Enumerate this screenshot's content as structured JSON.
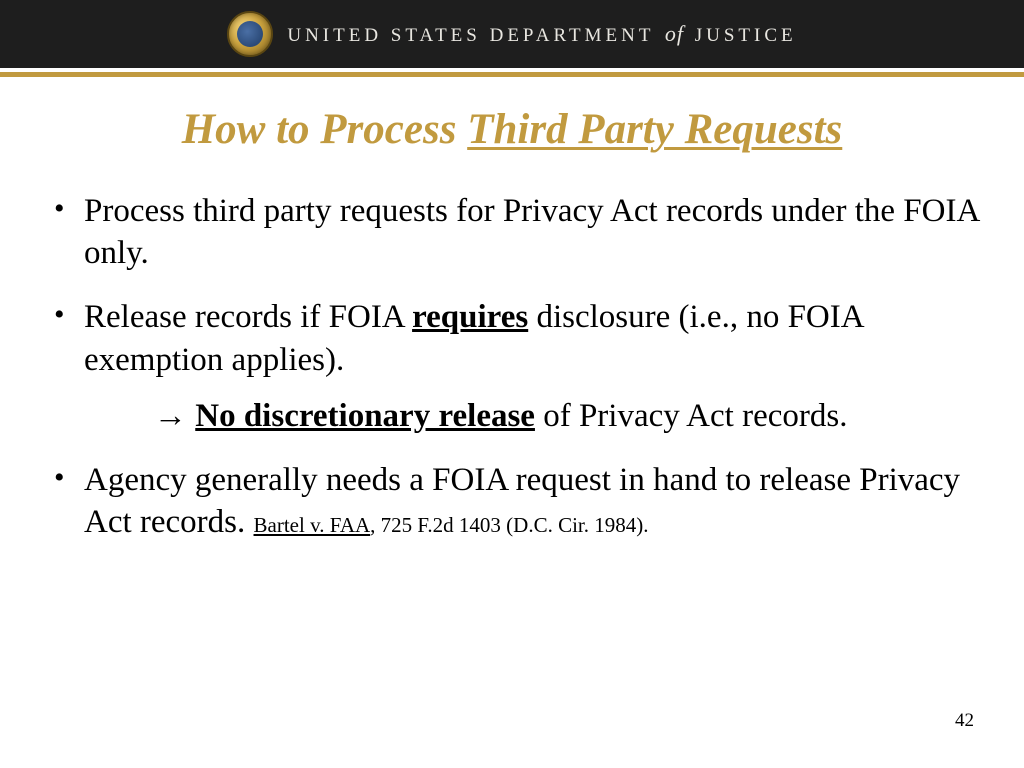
{
  "header": {
    "dept_prefix": "UNITED STATES DEPARTMENT",
    "dept_of": "of",
    "dept_suffix": "JUSTICE"
  },
  "title": {
    "prefix": "How to Process ",
    "underlined": "Third Party Requests"
  },
  "bullets": {
    "b1": "Process third party requests for Privacy Act records under the FOIA only.",
    "b2_pre": "Release records if  FOIA ",
    "b2_req": "requires",
    "b2_post": " disclosure (i.e., no FOIA exemption applies).",
    "b2_sub_arrow": "→ ",
    "b2_sub_bold": "No discretionary release",
    "b2_sub_post": " of  Privacy Act records.",
    "b3_main": "Agency generally needs a FOIA request in hand to release Privacy Act records.   ",
    "b3_cite_name": "Bartel v. FAA",
    "b3_cite_rest": ", 725 F.2d 1403 (D.C. Cir. 1984)."
  },
  "page_number": "42"
}
